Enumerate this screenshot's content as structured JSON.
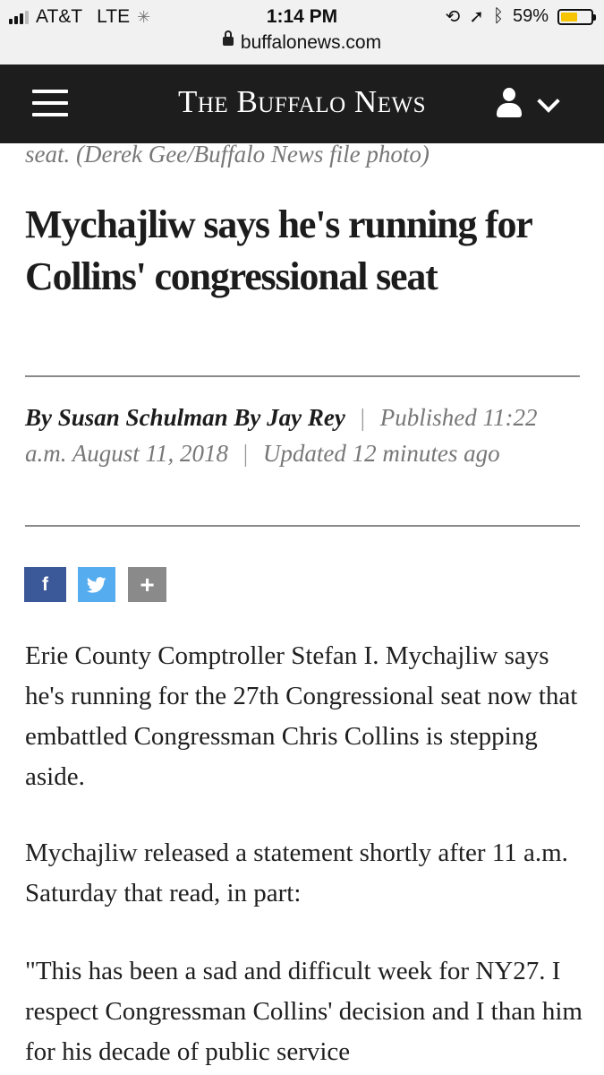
{
  "status_bar": {
    "carrier": "AT&T",
    "network": "LTE",
    "time": "1:14 PM",
    "battery": "59%",
    "battery_level": 0.59,
    "battery_color": "#f6c400"
  },
  "browser": {
    "url": "buffalonews.com"
  },
  "header": {
    "logo": "The Buffalo News",
    "menu_icon": "hamburger-menu-icon",
    "user_icon": "user-icon",
    "dropdown_icon": "chevron-down-icon",
    "background": "#1d1d1d"
  },
  "article": {
    "photo_caption": "seat. (Derek Gee/Buffalo News file photo)",
    "headline": "Mychajliw says he's running for Collins' congressional seat",
    "authors": [
      "By Susan Schulman",
      "By Jay Rey"
    ],
    "published": "Published 11:22 a.m. August 11, 2018",
    "separator": "|",
    "updated": "Updated 12 minutes ago",
    "paragraphs": [
      "Erie County Comptroller Stefan I. Mychajliw says he's running for the 27th Congressional seat now that embattled Congressman Chris Collins is stepping aside.",
      "Mychajliw released a statement shortly after 11 a.m. Saturday that read, in part:",
      "\"This has been a sad and difficult week for NY27. I respect Congressman Collins' decision and I than him for his decade of public service"
    ]
  },
  "share": {
    "facebook": "f",
    "twitter": "t",
    "more": "+",
    "facebook_color": "#3b5998",
    "twitter_color": "#55acee",
    "more_color": "#8a8a8a"
  }
}
